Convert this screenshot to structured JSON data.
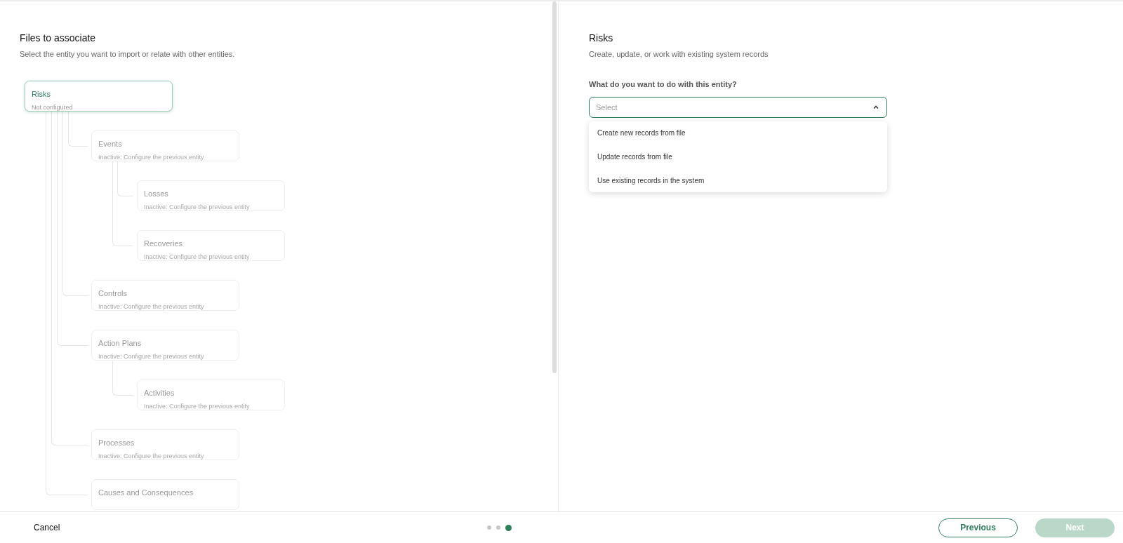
{
  "left_panel": {
    "title": "Files to associate",
    "description": "Select the entity you want to import or relate with other entities.",
    "tree": [
      {
        "title": "Risks",
        "subtitle": "Not configured",
        "disabled": false,
        "children": [
          {
            "title": "Events",
            "subtitle": "Inactive: Configure the previous entity",
            "disabled": true,
            "children": [
              {
                "title": "Losses",
                "subtitle": "Inactive: Configure the previous entity",
                "disabled": true
              },
              {
                "title": "Recoveries",
                "subtitle": "Inactive: Configure the previous entity",
                "disabled": true
              }
            ]
          },
          {
            "title": "Controls",
            "subtitle": "Inactive: Configure the previous entity",
            "disabled": true
          },
          {
            "title": "Action Plans",
            "subtitle": "Inactive: Configure the previous entity",
            "disabled": true,
            "children": [
              {
                "title": "Activities",
                "subtitle": "Inactive: Configure the previous entity",
                "disabled": true
              }
            ]
          },
          {
            "title": "Processes",
            "subtitle": "Inactive: Configure the previous entity",
            "disabled": true
          },
          {
            "title": "Causes and Consequences",
            "disabled": true
          }
        ]
      }
    ]
  },
  "right_panel": {
    "title": "Risks",
    "description": "Create, update, or work with existing system records",
    "question": "What do you want to do with this entity?",
    "select": {
      "placeholder": "Select",
      "expanded": true,
      "options": [
        {
          "label": "Create new records from file"
        },
        {
          "label": "Update records from file"
        },
        {
          "label": "Use existing records in the system"
        }
      ]
    }
  },
  "footer": {
    "cancel": "Cancel",
    "steps": [
      {
        "selected": false
      },
      {
        "selected": false
      },
      {
        "selected": true
      }
    ],
    "previous": {
      "label": "Previous",
      "disabled": false
    },
    "next": {
      "label": "Next",
      "disabled": true
    }
  }
}
